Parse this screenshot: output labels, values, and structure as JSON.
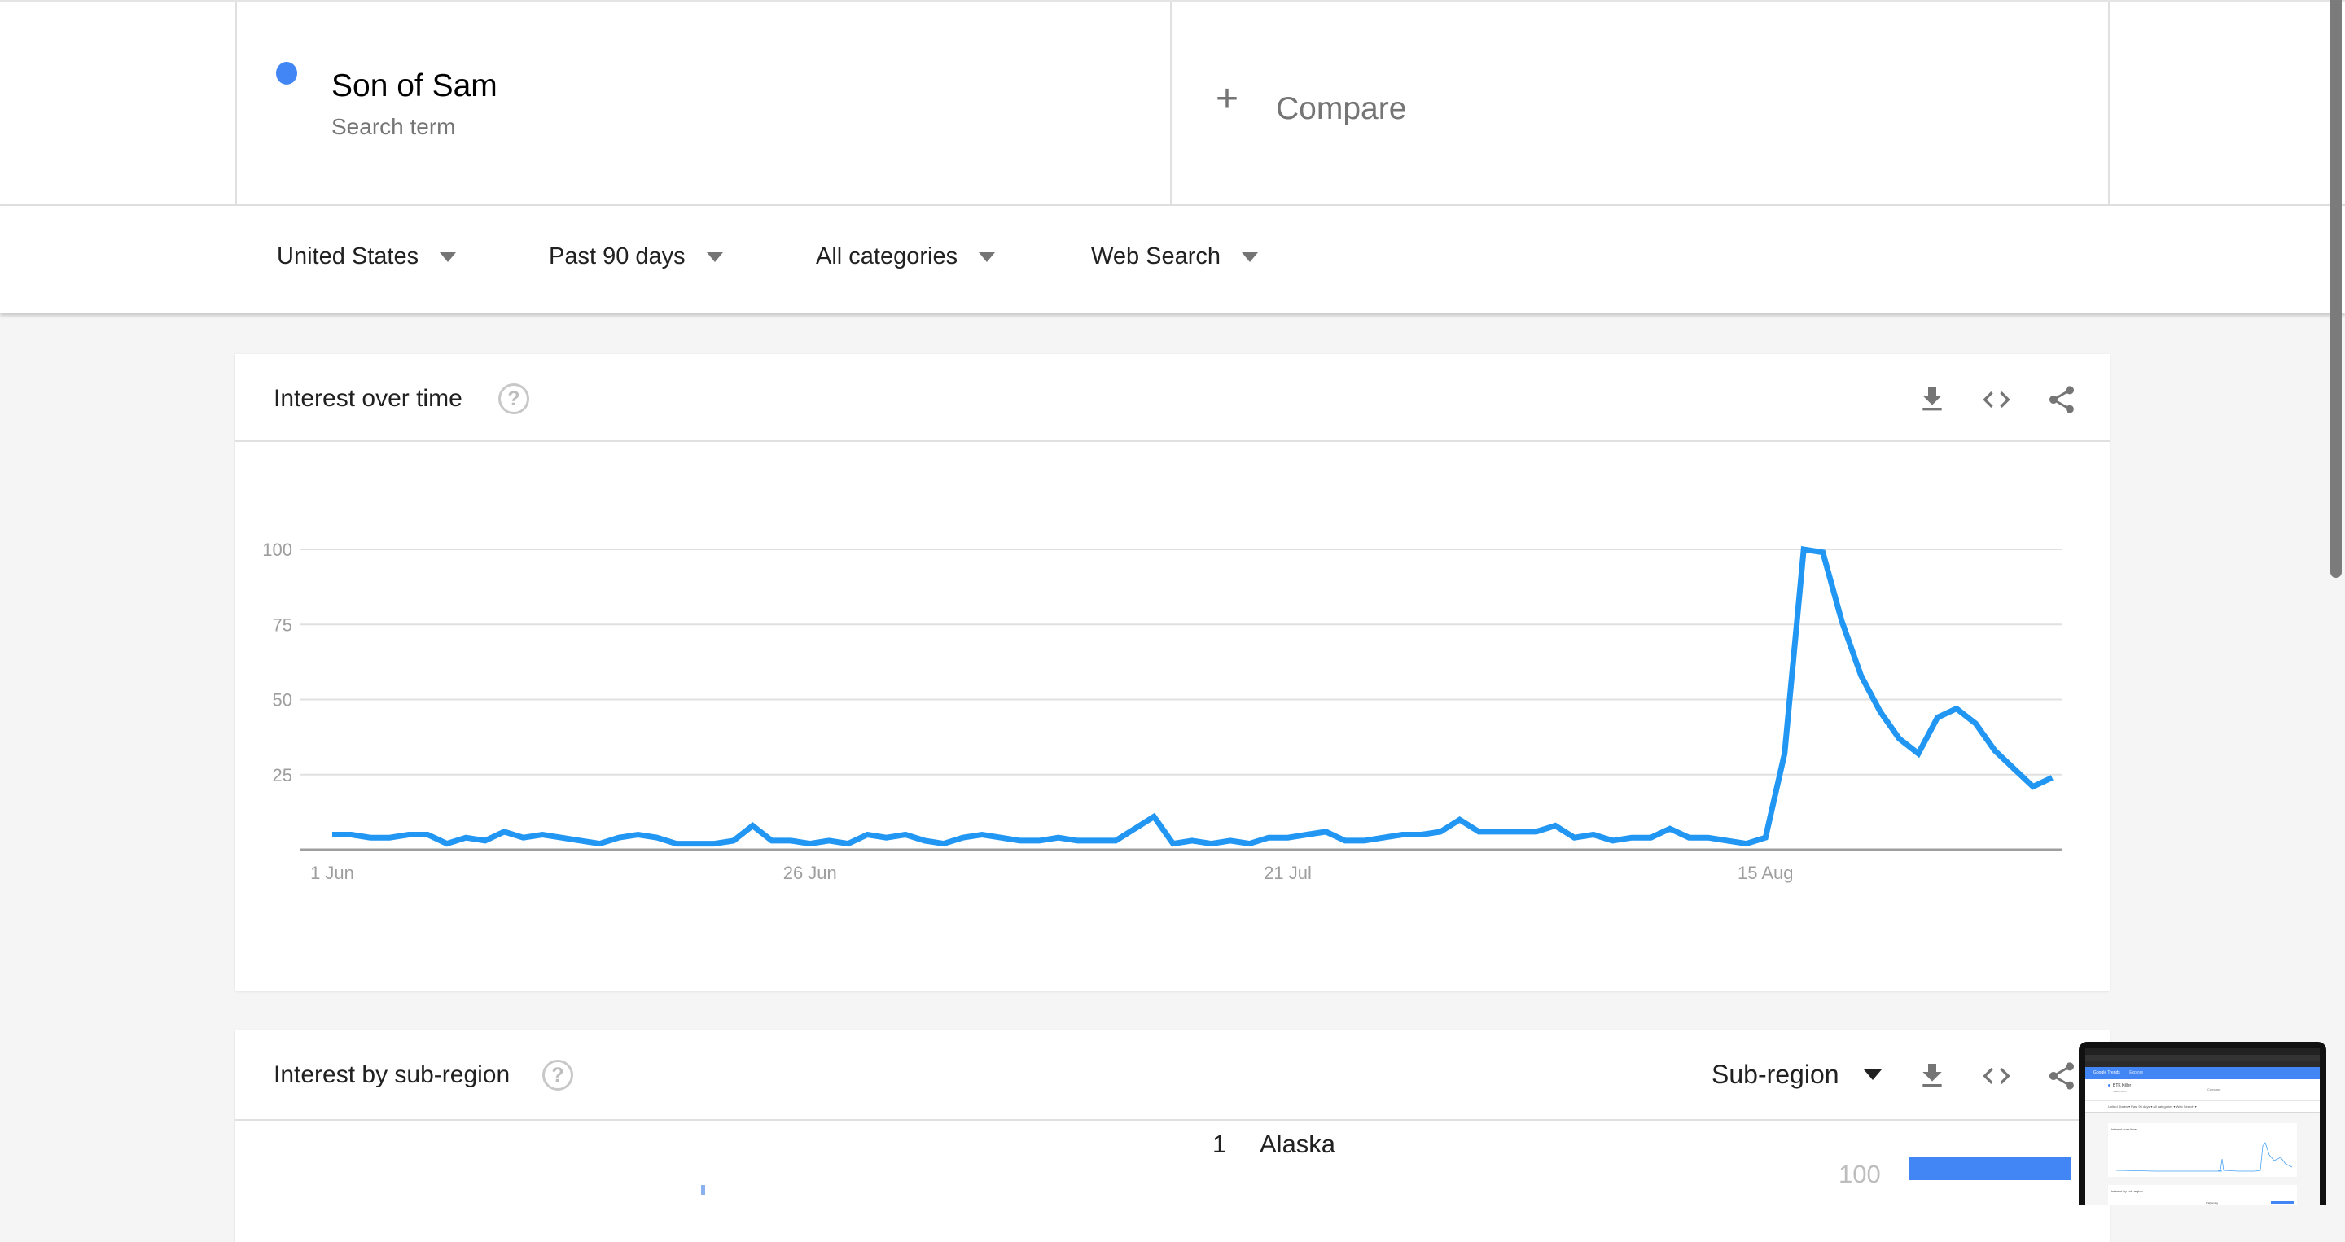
{
  "search": {
    "term": "Son of Sam",
    "term_sublabel": "Search term",
    "term_color": "#4285f4",
    "compare_label": "Compare",
    "compare_icon": "plus-icon"
  },
  "filters": [
    {
      "label": "United States",
      "icon": "caret-down-icon"
    },
    {
      "label": "Past 90 days",
      "icon": "caret-down-icon"
    },
    {
      "label": "All categories",
      "icon": "caret-down-icon"
    },
    {
      "label": "Web Search",
      "icon": "caret-down-icon"
    }
  ],
  "interest_over_time": {
    "title": "Interest over time",
    "help_icon": "?",
    "actions": [
      "download-icon",
      "embed-code-icon",
      "share-icon"
    ]
  },
  "chart_data": {
    "type": "line",
    "title": "Interest over time",
    "xlabel": "",
    "ylabel": "",
    "ylim": [
      0,
      100
    ],
    "yticks": [
      25,
      50,
      75,
      100
    ],
    "grid": true,
    "legend": "none",
    "x_start": "1 Jun",
    "x_end": "30 Aug",
    "x_interval": "1 day",
    "xtick_labels": [
      {
        "label": "1 Jun",
        "index": 0
      },
      {
        "label": "26 Jun",
        "index": 25
      },
      {
        "label": "21 Jul",
        "index": 50
      },
      {
        "label": "15 Aug",
        "index": 75
      }
    ],
    "series": [
      {
        "name": "Son of Sam",
        "color": "#2196f3",
        "values": [
          5,
          5,
          4,
          4,
          5,
          5,
          2,
          4,
          3,
          6,
          4,
          5,
          4,
          3,
          2,
          4,
          5,
          4,
          2,
          2,
          2,
          3,
          8,
          3,
          3,
          2,
          3,
          2,
          5,
          4,
          5,
          3,
          2,
          4,
          5,
          4,
          3,
          3,
          4,
          3,
          3,
          3,
          7,
          11,
          2,
          3,
          2,
          3,
          2,
          4,
          4,
          5,
          6,
          3,
          3,
          4,
          5,
          5,
          6,
          10,
          6,
          6,
          6,
          6,
          8,
          4,
          5,
          3,
          4,
          4,
          7,
          4,
          4,
          3,
          2,
          4,
          32,
          100,
          99,
          76,
          58,
          46,
          37,
          32,
          44,
          47,
          42,
          33,
          27,
          21,
          24
        ]
      }
    ]
  },
  "interest_by_subregion": {
    "title": "Interest by sub-region",
    "help_icon": "?",
    "view_select": "Sub-region",
    "actions": [
      "download-icon",
      "embed-code-icon",
      "share-icon"
    ],
    "rows": [
      {
        "rank": "1",
        "name": "Alaska",
        "value": 100,
        "value_label": "100"
      }
    ],
    "bar_color": "#4285f4"
  },
  "screenshot_thumbnail": {
    "app_name": "Google Trends",
    "nav": "Explore",
    "term": "BTK Killer",
    "term_sublabel": "Search term",
    "compare": "Compare",
    "filters": "United States ▾   Past 90 days ▾   All categories ▾   Web Search ▾",
    "card1_title": "Interest over time",
    "card2_title": "Interest by sub-region",
    "card2_select": "Sub-region",
    "row1": "1  Wyoming"
  }
}
